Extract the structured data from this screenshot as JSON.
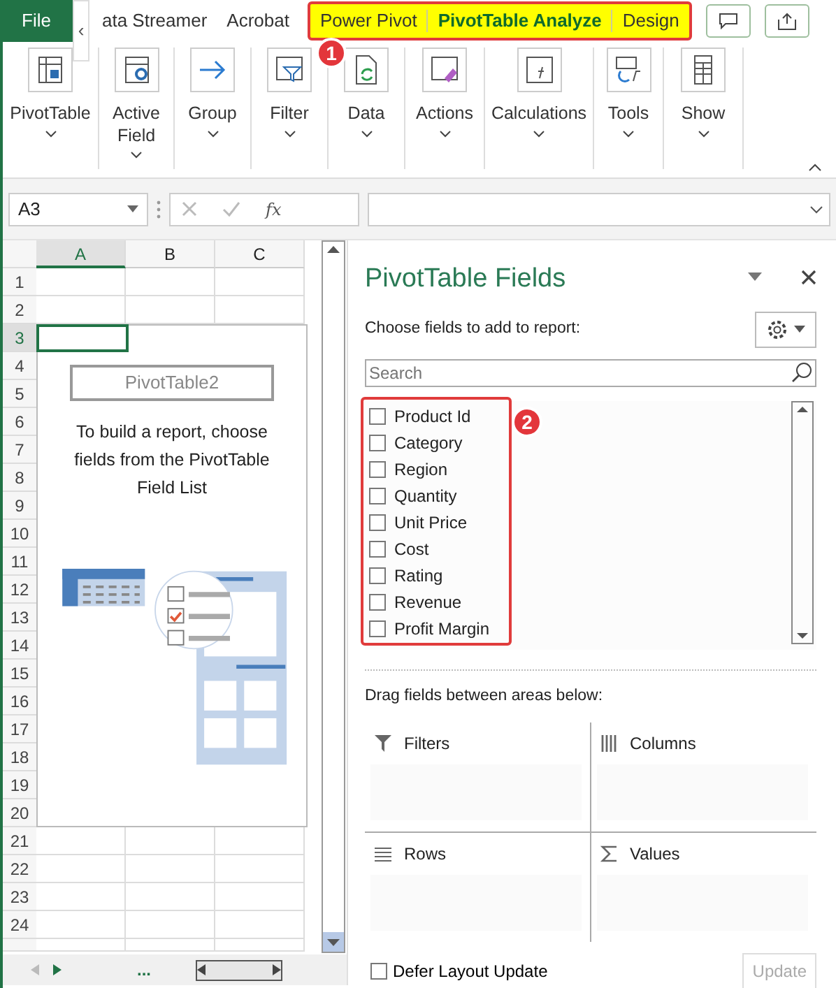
{
  "ribbon_tabs": [
    {
      "label": "File",
      "kind": "file",
      "selected": false,
      "highlighted": false
    },
    {
      "label": "‹",
      "kind": "scroll",
      "selected": false,
      "highlighted": false
    },
    {
      "label": "ata Streamer",
      "kind": "tab",
      "selected": false,
      "highlighted": false
    },
    {
      "label": "Acrobat",
      "kind": "tab",
      "selected": false,
      "highlighted": false
    },
    {
      "label": "Power Pivot",
      "kind": "tab",
      "selected": false,
      "highlighted": true
    },
    {
      "label": "PivotTable Analyze",
      "kind": "tab",
      "selected": true,
      "highlighted": true
    },
    {
      "label": "Design",
      "kind": "tab",
      "selected": false,
      "highlighted": true
    }
  ],
  "ribbon_groups": [
    {
      "label": "PivotTable",
      "kind": "table"
    },
    {
      "label": "Active Field",
      "kind": "field"
    },
    {
      "label": "Group",
      "kind": "arrow"
    },
    {
      "label": "Filter",
      "kind": "filter"
    },
    {
      "label": "Data",
      "kind": "refresh"
    },
    {
      "label": "Actions",
      "kind": "eraser"
    },
    {
      "label": "Calculations",
      "kind": "fx"
    },
    {
      "label": "Tools",
      "kind": "tools"
    },
    {
      "label": "Show",
      "kind": "list"
    }
  ],
  "name_box": "A3",
  "function_label": "fx",
  "columns": [
    {
      "label": "A",
      "selected": true
    },
    {
      "label": "B",
      "selected": false
    },
    {
      "label": "C",
      "selected": false
    }
  ],
  "rows": [
    {
      "label": "1",
      "selected": false
    },
    {
      "label": "2",
      "selected": false
    },
    {
      "label": "3",
      "selected": true
    },
    {
      "label": "4",
      "selected": false
    },
    {
      "label": "5",
      "selected": false
    },
    {
      "label": "6",
      "selected": false
    },
    {
      "label": "7",
      "selected": false
    },
    {
      "label": "8",
      "selected": false
    },
    {
      "label": "9",
      "selected": false
    },
    {
      "label": "10",
      "selected": false
    },
    {
      "label": "11",
      "selected": false
    },
    {
      "label": "12",
      "selected": false
    },
    {
      "label": "13",
      "selected": false
    },
    {
      "label": "14",
      "selected": false
    },
    {
      "label": "15",
      "selected": false
    },
    {
      "label": "16",
      "selected": false
    },
    {
      "label": "17",
      "selected": false
    },
    {
      "label": "18",
      "selected": false
    },
    {
      "label": "19",
      "selected": false
    },
    {
      "label": "20",
      "selected": false
    },
    {
      "label": "21",
      "selected": false
    },
    {
      "label": "22",
      "selected": false
    },
    {
      "label": "23",
      "selected": false
    },
    {
      "label": "24",
      "selected": false
    }
  ],
  "placeholder": {
    "title": "PivotTable2",
    "message": "To build a report, choose fields from the PivotTable Field List"
  },
  "sheet_tabs_more": "...",
  "pane": {
    "title": "PivotTable Fields",
    "subtitle": "Choose fields to add to report:",
    "search": {
      "placeholder": "Search"
    },
    "fields": [
      {
        "label": "Product Id",
        "checked": false
      },
      {
        "label": "Category",
        "checked": false
      },
      {
        "label": "Region",
        "checked": false
      },
      {
        "label": "Quantity",
        "checked": false
      },
      {
        "label": "Unit Price",
        "checked": false
      },
      {
        "label": "Cost",
        "checked": false
      },
      {
        "label": "Rating",
        "checked": false
      },
      {
        "label": "Revenue",
        "checked": false
      },
      {
        "label": "Profit Margin",
        "checked": false
      }
    ],
    "areas_hint": "Drag fields between areas below:",
    "areas": [
      {
        "label": "Filters",
        "kind": "filters"
      },
      {
        "label": "Columns",
        "kind": "columns"
      },
      {
        "label": "Rows",
        "kind": "rows"
      },
      {
        "label": "Values",
        "kind": "values"
      }
    ],
    "defer": {
      "label": "Defer Layout Update",
      "checked": false
    },
    "update": {
      "label": "Update",
      "disabled": true
    }
  },
  "callouts": [
    "1",
    "2"
  ]
}
